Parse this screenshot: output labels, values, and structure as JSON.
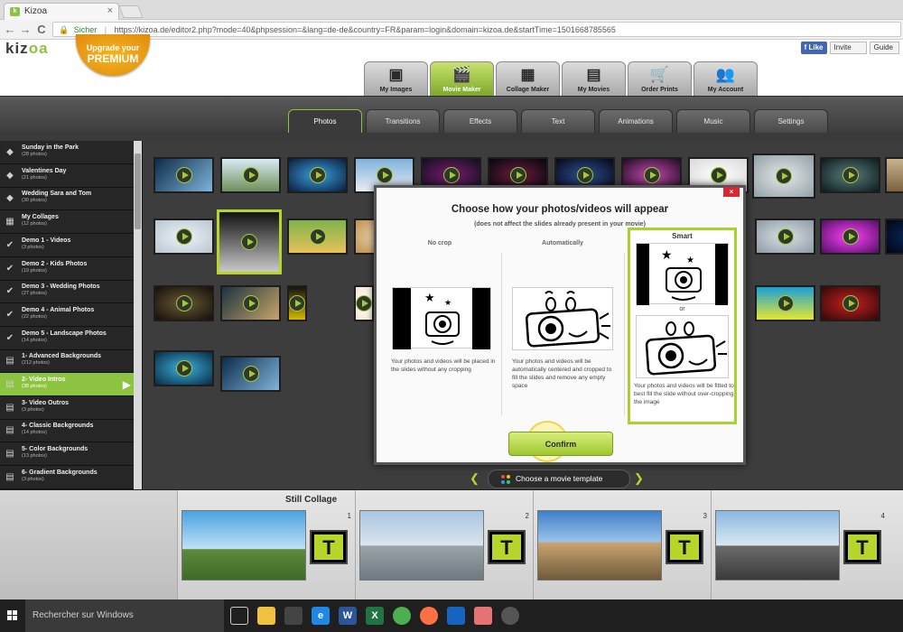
{
  "browser": {
    "tab_title": "Kizoa",
    "tab_close": "×",
    "back": "←",
    "forward": "→",
    "reload": "C",
    "lock": "🔒",
    "secure_label": "Sicher",
    "url": "https://kizoa.de/editor2.php?mode=40&phpsession=&lang=de-de&country=FR&param=login&domain=kizoa.de&startTime=1501668785565"
  },
  "header": {
    "logo_a": "kiz",
    "logo_b": "oa",
    "premium_line1": "Upgrade your",
    "premium_line2": "PREMIUM",
    "fb_like": "Like",
    "invite": "Invite",
    "guide": "Guide"
  },
  "main_tabs": [
    {
      "label": "My Images",
      "icon": "▣"
    },
    {
      "label": "Movie Maker",
      "icon": "🎬"
    },
    {
      "label": "Collage Maker",
      "icon": "▦"
    },
    {
      "label": "My Movies",
      "icon": "▤"
    },
    {
      "label": "Order Prints",
      "icon": "🛒"
    },
    {
      "label": "My Account",
      "icon": "👥"
    }
  ],
  "sub_tabs": [
    "Photos",
    "Transitions",
    "Effects",
    "Text",
    "Animations",
    "Music",
    "Settings"
  ],
  "sidebar": [
    {
      "title": "Sunday in the Park",
      "count": "(28 photos)",
      "icon": "◆"
    },
    {
      "title": "Valentines Day",
      "count": "(21 photos)",
      "icon": "◆"
    },
    {
      "title": "Wedding Sara and Tom",
      "count": "(30 photos)",
      "icon": "◆"
    },
    {
      "title": "My Collages",
      "count": "(12 photos)",
      "icon": "▦"
    },
    {
      "title": "Demo 1 - Videos",
      "count": "(3 photos)",
      "icon": "✔"
    },
    {
      "title": "Demo 2 - Kids Photos",
      "count": "(19 photos)",
      "icon": "✔"
    },
    {
      "title": "Demo 3 - Wedding Photos",
      "count": "(27 photos)",
      "icon": "✔"
    },
    {
      "title": "Demo 4 - Animal Photos",
      "count": "(22 photos)",
      "icon": "✔"
    },
    {
      "title": "Demo 5 - Landscape Photos",
      "count": "(14 photos)",
      "icon": "✔"
    },
    {
      "title": "1- Advanced Backgrounds",
      "count": "(212 photos)",
      "icon": "▤"
    },
    {
      "title": "2- Video Intros",
      "count": "(38 photos)",
      "icon": "▤",
      "active": true
    },
    {
      "title": "3- Video Outros",
      "count": "(3 photos)",
      "icon": "▤"
    },
    {
      "title": "4- Classic Backgrounds",
      "count": "(14 photos)",
      "icon": "▤"
    },
    {
      "title": "5- Color Backgrounds",
      "count": "(13 photos)",
      "icon": "▤"
    },
    {
      "title": "6- Gradient Backgrounds",
      "count": "(3 photos)",
      "icon": "▤"
    }
  ],
  "modal": {
    "close": "×",
    "title": "Choose how your photos/videos will appear",
    "subtitle": "(does not affect the slides already present in your movie)",
    "options": [
      {
        "heading": "No crop",
        "description": "Your photos and videos will be placed in the slides without any cropping"
      },
      {
        "heading": "Automatically",
        "description": "Your photos and videos will be automatically centered and cropped to fill the slides and remove any empty space"
      },
      {
        "heading": "Smart",
        "description": "Your photos and videos will be fitted to best fill the slide without over-cropping the image"
      }
    ],
    "or": "or",
    "confirm": "Confirm"
  },
  "choose_template": "Choose a movie template",
  "timeline": {
    "title": "Still Collage",
    "slots": [
      {
        "number": "1",
        "t": "T"
      },
      {
        "number": "2",
        "t": "T"
      },
      {
        "number": "3",
        "t": "T"
      },
      {
        "number": "4",
        "t": "T"
      }
    ]
  },
  "taskbar": {
    "search_placeholder": "Rechercher sur Windows"
  },
  "colors": {
    "accent": "#8dc43f",
    "highlight": "#b6d62b",
    "close_red": "#d9282f"
  }
}
